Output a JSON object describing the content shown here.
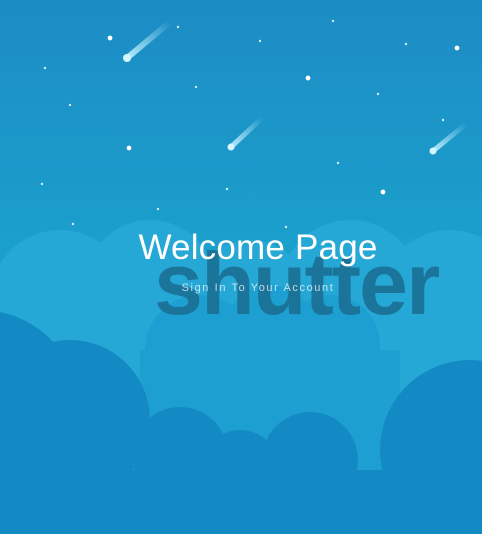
{
  "welcome": {
    "title": "Welcome Page",
    "subtitle": "Sign In To Your Account"
  },
  "watermark": {
    "text": "shutter"
  },
  "colors": {
    "sky_top": "#1c8cc4",
    "sky_bottom": "#1aa8d0",
    "cloud_back": "#26a8d6",
    "cloud_front": "#148ac4",
    "watermark": "#1a6f92",
    "text": "#ffffff"
  }
}
